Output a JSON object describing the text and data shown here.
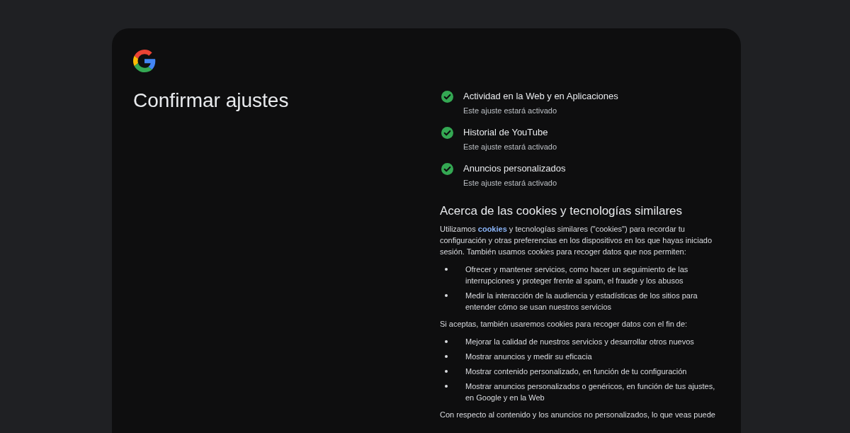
{
  "card": {
    "title": "Confirmar ajustes",
    "settings": [
      {
        "name": "Actividad en la Web y en Aplicaciones",
        "status": "Este ajuste estará activado",
        "checked": true
      },
      {
        "name": "Historial de YouTube",
        "status": "Este ajuste estará activado",
        "checked": true
      },
      {
        "name": "Anuncios personalizados",
        "status": "Este ajuste estará activado",
        "checked": true
      }
    ],
    "cookies_section": {
      "heading": "Acerca de las cookies y tecnologías similares",
      "intro": {
        "before": "Utilizamos ",
        "link": "cookies",
        "after": " y tecnologías similares (\"cookies\") para recordar tu configuración y otras preferencias en los dispositivos en los que hayas iniciado sesión. También usamos cookies para recoger datos que nos permiten:"
      },
      "uses": [
        "Ofrecer y mantener servicios, como hacer un seguimiento de las interrupciones y proteger frente al spam, el fraude y los abusos",
        "Medir la interacción de la audiencia y estadísticas de los sitios para entender cómo se usan nuestros servicios"
      ],
      "consent_text": "Si aceptas, también usaremos cookies para recoger datos con el fin de:",
      "consent_uses": [
        "Mejorar la calidad de nuestros servicios y desarrollar otros nuevos",
        "Mostrar anuncios y medir su eficacia",
        "Mostrar contenido personalizado, en función de tu configuración",
        "Mostrar anuncios personalizados o genéricos, en función de tus ajustes, en Google y en la Web"
      ],
      "non_personalized_text": "Con respecto al contenido y los anuncios no personalizados, lo que veas puede"
    }
  }
}
